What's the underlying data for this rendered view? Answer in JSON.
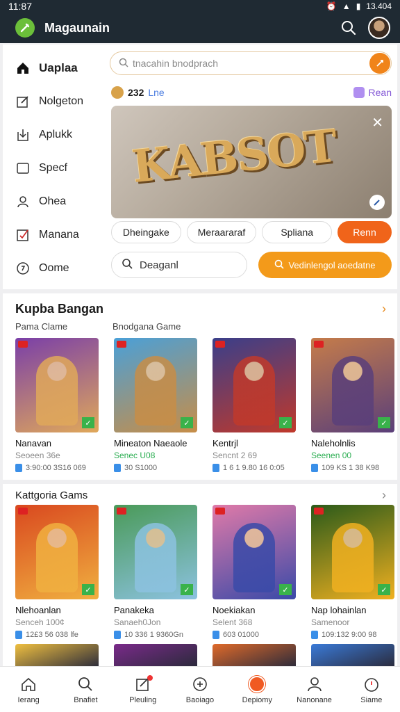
{
  "status": {
    "time": "11:87",
    "right": "13.404"
  },
  "app": {
    "title": "Magaunain"
  },
  "sidebar": {
    "items": [
      {
        "label": "Uaplaa",
        "icon": "home-icon",
        "active": true
      },
      {
        "label": "Nolgeton",
        "icon": "edit-icon"
      },
      {
        "label": "Aplukk",
        "icon": "download-icon"
      },
      {
        "label": "Specf",
        "icon": "square-icon"
      },
      {
        "label": "Ohea",
        "icon": "user-icon"
      },
      {
        "label": "Manana",
        "icon": "checkbox-icon"
      },
      {
        "label": "Oome",
        "icon": "badge-icon"
      }
    ]
  },
  "search": {
    "placeholder": "tnacahin bnodprach"
  },
  "meta": {
    "left_value": "232",
    "left_tag": "Lne",
    "right_label": "Rean"
  },
  "hero": {
    "title": "KABSOT"
  },
  "chips": [
    "Dheingake",
    "Meraararaf",
    "Spliana",
    "Renn"
  ],
  "search2": {
    "label": "Deaganl"
  },
  "cta": {
    "label": "Vedinlengol aoedatne"
  },
  "section1": {
    "title": "Kupba Bangan",
    "sub_left": "Pama Clame",
    "sub_right": "Bnodgana Game",
    "cards": [
      {
        "name": "Nanavan",
        "sub": "Seoeen 36e",
        "meta": "3:90:00 3S16 069",
        "colors": [
          "#7a3fa8",
          "#e0a85a"
        ]
      },
      {
        "name": "Mineaton Naeaole",
        "sub": "Senec U08",
        "sub_green": true,
        "meta": "30 S1000",
        "colors": [
          "#4aa0d8",
          "#c78d47"
        ]
      },
      {
        "name": "Kentrjl",
        "sub": "Sencnt 2 69",
        "meta": "1 6 1 9.80 16 0:05",
        "colors": [
          "#3a3f8a",
          "#c0392b"
        ]
      },
      {
        "name": "Naleholnlis",
        "sub": "Seenen 00",
        "sub_green": true,
        "meta": "109 KS 1 38 K98",
        "colors": [
          "#c57c4a",
          "#5a3f7a"
        ]
      }
    ]
  },
  "section2": {
    "title": "Kattgoria Gams",
    "cards": [
      {
        "name": "Nlehoanlan",
        "sub": "Senceh 100¢",
        "meta": "12£3 56 038 lfe",
        "colors": [
          "#d9481f",
          "#f0b040"
        ]
      },
      {
        "name": "Panakeka",
        "sub": "Sanaeh0Jon",
        "meta": "10 336 1 9360Gn",
        "colors": [
          "#4a9a58",
          "#8cc2e0"
        ]
      },
      {
        "name": "Noekiakan",
        "sub": "Selent 368",
        "meta": "603 01000",
        "colors": [
          "#e07aa8",
          "#3a4aa8"
        ]
      },
      {
        "name": "Nap lohainlan",
        "sub": "Samenoor",
        "meta": "109:132 9:00 98",
        "colors": [
          "#2a5a1a",
          "#f0b020"
        ]
      }
    ]
  },
  "peek_colors": [
    "#f0c040",
    "#7a2a8a",
    "#e06a2a",
    "#3a7ad8"
  ],
  "bottom_nav": [
    {
      "label": "Ierang",
      "icon": "home-icon"
    },
    {
      "label": "Bnafiet",
      "icon": "search-icon"
    },
    {
      "label": "Pleuling",
      "icon": "edit-icon",
      "notif": true
    },
    {
      "label": "Baoiago",
      "icon": "gamepad-icon"
    },
    {
      "label": "Depiomy",
      "icon": "ball-icon",
      "active": true
    },
    {
      "label": "Nanonane",
      "icon": "user-icon"
    },
    {
      "label": "Siame",
      "icon": "timer-icon"
    }
  ]
}
